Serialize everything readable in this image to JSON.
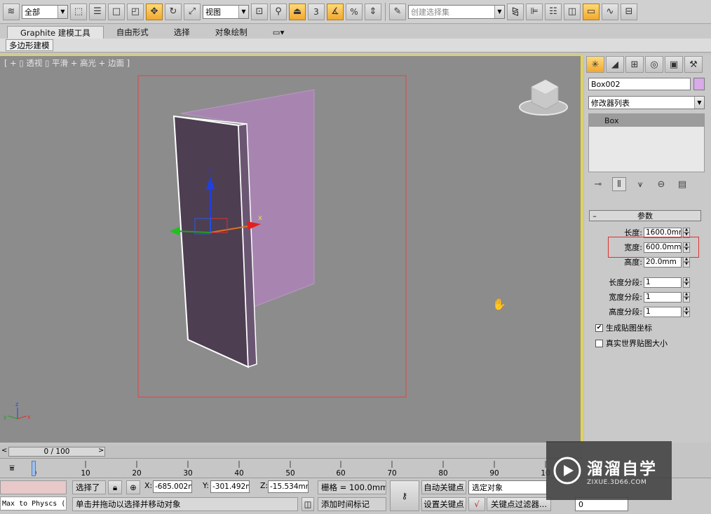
{
  "toolbar": {
    "selection_filter": "全部",
    "reference_coord": "视图",
    "named_selection_placeholder": "创建选择集",
    "snap_value": "3",
    "percent_snap": "%"
  },
  "ribbon": {
    "tabs": [
      {
        "label": "Graphite 建模工具",
        "active": true
      },
      {
        "label": "自由形式",
        "active": false
      },
      {
        "label": "选择",
        "active": false
      },
      {
        "label": "对象绘制",
        "active": false
      }
    ],
    "sub_tab": "多边形建模"
  },
  "viewport": {
    "label": "[ + ▯ 透视 ▯ 平滑 + 高光 + 边面 ]",
    "gizmo_x": "x",
    "gizmo_z": "z",
    "axis_x": "x",
    "axis_y": "y",
    "axis_z": "z",
    "object_color": "#d5aee9",
    "border_color": "#e8d63a"
  },
  "command_panel": {
    "object_name": "Box002",
    "object_color": "#d8aae8",
    "modifier_list": "修改器列表",
    "stack_items": [
      "Box"
    ],
    "rollout_title": "参数",
    "params": [
      {
        "label": "长度:",
        "value": "1600.0mm"
      },
      {
        "label": "宽度:",
        "value": "600.0mm"
      },
      {
        "label": "高度:",
        "value": "20.0mm"
      },
      {
        "label": "长度分段:",
        "value": "1"
      },
      {
        "label": "宽度分段:",
        "value": "1"
      },
      {
        "label": "高度分段:",
        "value": "1"
      }
    ],
    "checks": [
      {
        "label": "生成贴图坐标",
        "checked": true
      },
      {
        "label": "真实世界贴图大小",
        "checked": false
      }
    ]
  },
  "timeline": {
    "frame_display": "0 / 100",
    "ticks": [
      "0",
      "10",
      "20",
      "30",
      "40",
      "50",
      "60",
      "70",
      "80",
      "90",
      "10"
    ]
  },
  "status": {
    "maxscript": "Max to Physcs (",
    "selected": "选择了",
    "x_label": "X:",
    "x_value": "-685.002m",
    "y_label": "Y:",
    "y_value": "-301.492m",
    "z_label": "Z:",
    "z_value": "-15.534mm",
    "grid": "栅格 = 100.0mm",
    "prompt": "单击并拖动以选择并移动对象",
    "add_time_tag": "添加时间标记",
    "auto_key": "自动关键点",
    "set_key": "设置关键点",
    "selected_object": "选定对象",
    "key_filters": "关键点过滤器...",
    "frame_field": "0"
  },
  "watermark": {
    "title": "溜溜自学",
    "url": "ZIXUE.3D66.COM"
  }
}
